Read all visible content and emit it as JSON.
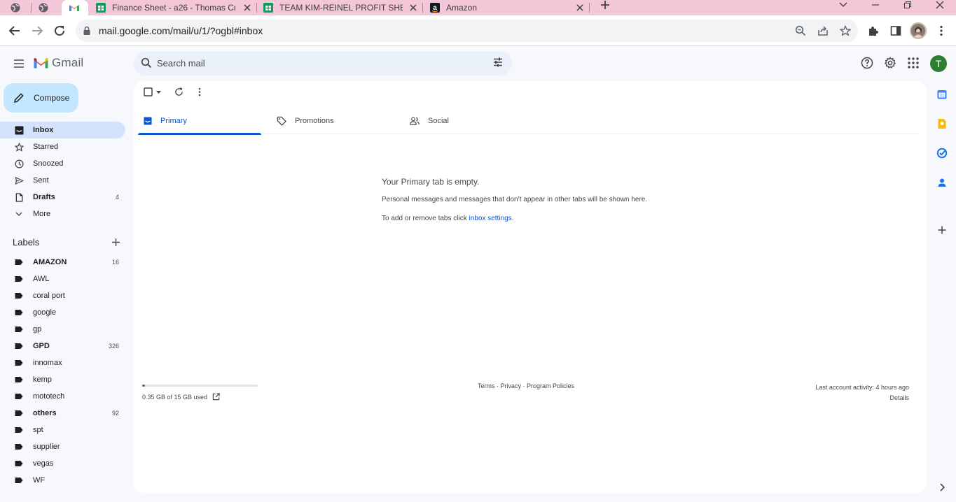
{
  "browser": {
    "tabs": [
      {
        "title": "",
        "icon": "globe-icon"
      },
      {
        "title": "",
        "icon": "globe-icon"
      },
      {
        "title": "",
        "icon": "gmail-icon",
        "active": true
      },
      {
        "title": "Finance Sheet - a26 - Thomas Cr",
        "icon": "sheets-icon"
      },
      {
        "title": "TEAM KIM-REINEL PROFIT SHEET",
        "icon": "sheets-icon"
      },
      {
        "title": "Amazon",
        "icon": "amazon-icon"
      }
    ],
    "url": "mail.google.com/mail/u/1/?ogbl#inbox"
  },
  "gmail": {
    "logo_text": "Gmail",
    "search_placeholder": "Search mail",
    "account_initial": "T",
    "compose_label": "Compose",
    "nav": [
      {
        "label": "Inbox",
        "icon": "inbox-icon",
        "count": "",
        "selected": true
      },
      {
        "label": "Starred",
        "icon": "star-icon",
        "count": ""
      },
      {
        "label": "Snoozed",
        "icon": "clock-icon",
        "count": ""
      },
      {
        "label": "Sent",
        "icon": "send-icon",
        "count": ""
      },
      {
        "label": "Drafts",
        "icon": "draft-icon",
        "count": "4",
        "bold": true
      },
      {
        "label": "More",
        "icon": "chevron-down-icon",
        "count": ""
      }
    ],
    "labels_heading": "Labels",
    "labels": [
      {
        "label": "AMAZON",
        "count": "16",
        "bold": true
      },
      {
        "label": "AWL",
        "count": ""
      },
      {
        "label": "coral port",
        "count": ""
      },
      {
        "label": "google",
        "count": ""
      },
      {
        "label": "gp",
        "count": ""
      },
      {
        "label": "GPD",
        "count": "326",
        "bold": true
      },
      {
        "label": "innomax",
        "count": ""
      },
      {
        "label": "kemp",
        "count": ""
      },
      {
        "label": "mototech",
        "count": ""
      },
      {
        "label": "others",
        "count": "92",
        "bold": true
      },
      {
        "label": "spt",
        "count": ""
      },
      {
        "label": "supplier",
        "count": ""
      },
      {
        "label": "vegas",
        "count": ""
      },
      {
        "label": "WF",
        "count": ""
      }
    ],
    "category_tabs": [
      {
        "label": "Primary",
        "icon": "inbox-icon",
        "selected": true
      },
      {
        "label": "Promotions",
        "icon": "tag-icon"
      },
      {
        "label": "Social",
        "icon": "people-icon"
      }
    ],
    "empty": {
      "title": "Your Primary tab is empty.",
      "description": "Personal messages and messages that don’t appear in other tabs will be shown here.",
      "settings_prefix": "To add or remove tabs click ",
      "settings_link": "inbox settings",
      "settings_suffix": "."
    },
    "footer": {
      "storage_text": "0.35 GB of 15 GB used",
      "storage_fraction": 0.023,
      "links": "Terms · Privacy · Program Policies",
      "activity": "Last account activity: 4 hours ago",
      "details": "Details"
    }
  },
  "colors": {
    "accent": "#0b57d0",
    "compose_bg": "#c2e7ff",
    "nav_selected": "#d3e3fd",
    "tab_strip": "#f3c6d8",
    "account": "#2e7d32"
  }
}
